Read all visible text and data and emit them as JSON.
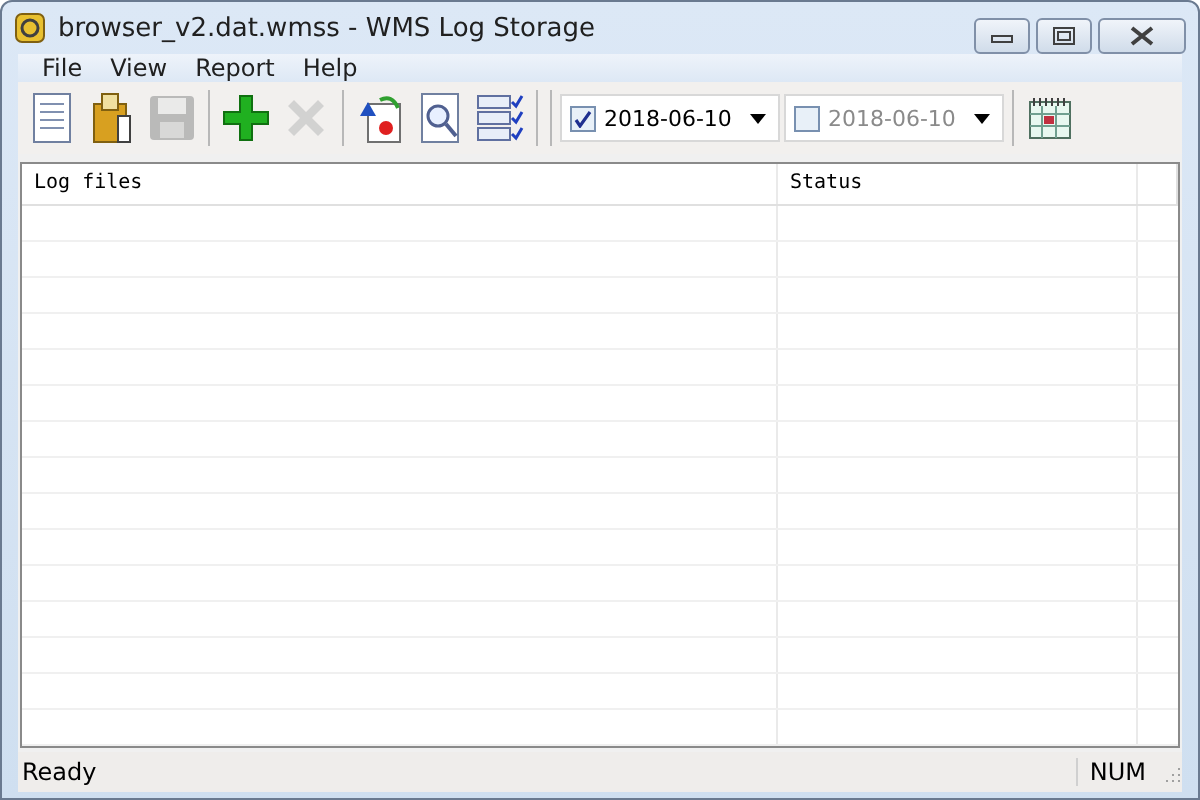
{
  "window": {
    "title": "browser_v2.dat.wmss - WMS Log Storage"
  },
  "menu": [
    {
      "label": "File"
    },
    {
      "label": "View"
    },
    {
      "label": "Report"
    },
    {
      "label": "Help"
    }
  ],
  "toolbar": [
    {
      "kind": "new",
      "disabled": false
    },
    {
      "kind": "open",
      "disabled": false
    },
    {
      "kind": "save",
      "disabled": true
    },
    {
      "kind": "add",
      "disabled": false
    },
    {
      "kind": "delete",
      "disabled": true
    },
    {
      "kind": "import",
      "disabled": false
    },
    {
      "kind": "preview",
      "disabled": false
    },
    {
      "kind": "checklist",
      "disabled": false
    }
  ],
  "date_pickers": [
    {
      "value": "2018-06-10",
      "checked": true
    },
    {
      "value": "2018-06-10",
      "checked": false
    }
  ],
  "table": {
    "columns": [
      "Log files",
      "Status"
    ]
  },
  "status_bar": {
    "message": "Ready",
    "indicator": "NUM"
  }
}
